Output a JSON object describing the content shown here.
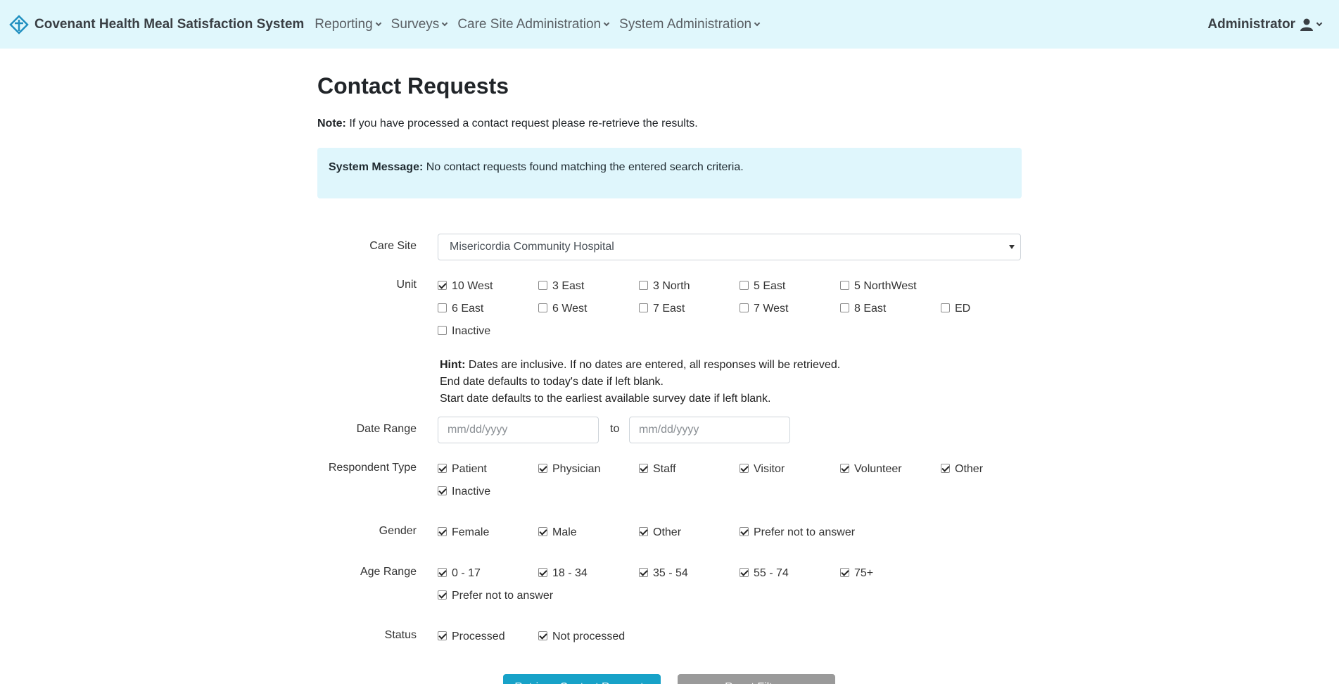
{
  "navbar": {
    "brand": "Covenant Health Meal Satisfaction System",
    "items": [
      {
        "label": "Reporting"
      },
      {
        "label": "Surveys"
      },
      {
        "label": "Care Site Administration"
      },
      {
        "label": "System Administration"
      }
    ],
    "user": "Administrator"
  },
  "page": {
    "title": "Contact Requests",
    "note_label": "Note:",
    "note_text": " If you have processed a contact request please re-retrieve the results.",
    "alert_label": "System Message:",
    "alert_text": " No contact requests found matching the entered search criteria."
  },
  "form": {
    "care_site_label": "Care Site",
    "care_site_value": "Misericordia Community Hospital",
    "unit_label": "Unit",
    "units": [
      {
        "label": "10 West",
        "checked": true
      },
      {
        "label": "3 East",
        "checked": false
      },
      {
        "label": "3 North",
        "checked": false
      },
      {
        "label": "5 East",
        "checked": false
      },
      {
        "label": "5 NorthWest",
        "checked": false
      },
      {
        "label": "6 East",
        "checked": false
      },
      {
        "label": "6 West",
        "checked": false
      },
      {
        "label": "7 East",
        "checked": false
      },
      {
        "label": "7 West",
        "checked": false
      },
      {
        "label": "8 East",
        "checked": false
      },
      {
        "label": "ED",
        "checked": false
      },
      {
        "label": "Inactive",
        "checked": false
      }
    ],
    "hint_label": "Hint:",
    "hint_line1": " Dates are inclusive. If no dates are entered, all responses will be retrieved.",
    "hint_line2": "End date defaults to today's date if left blank.",
    "hint_line3": "Start date defaults to the earliest available survey date if left blank.",
    "date_range_label": "Date Range",
    "date_from_placeholder": "mm/dd/yyyy",
    "date_to_label": "to",
    "date_to_placeholder": "mm/dd/yyyy",
    "respondent_label": "Respondent Type",
    "respondents": [
      {
        "label": "Patient",
        "checked": true
      },
      {
        "label": "Physician",
        "checked": true
      },
      {
        "label": "Staff",
        "checked": true
      },
      {
        "label": "Visitor",
        "checked": true
      },
      {
        "label": "Volunteer",
        "checked": true
      },
      {
        "label": "Other",
        "checked": true
      },
      {
        "label": "Inactive",
        "checked": true
      }
    ],
    "gender_label": "Gender",
    "genders": [
      {
        "label": "Female",
        "checked": true
      },
      {
        "label": "Male",
        "checked": true
      },
      {
        "label": "Other",
        "checked": true
      },
      {
        "label": "Prefer not to answer",
        "checked": true
      }
    ],
    "age_label": "Age Range",
    "ages": [
      {
        "label": "0 - 17",
        "checked": true
      },
      {
        "label": "18 - 34",
        "checked": true
      },
      {
        "label": "35 - 54",
        "checked": true
      },
      {
        "label": "55 - 74",
        "checked": true
      },
      {
        "label": "75+",
        "checked": true
      },
      {
        "label": "Prefer not to answer",
        "checked": true
      }
    ],
    "status_label": "Status",
    "statuses": [
      {
        "label": "Processed",
        "checked": true
      },
      {
        "label": "Not processed",
        "checked": true
      }
    ],
    "retrieve_button": "Retrieve Contact Requests",
    "reset_button": "Reset Filters"
  },
  "colors": {
    "navbar_bg": "#e0f7fc",
    "alert_bg": "#dff6fc",
    "primary": "#17a2c8",
    "secondary": "#9a9a9a"
  },
  "icons": {
    "brand": "cross-diamond-logo-icon",
    "user": "user-icon",
    "caret": "chevron-down-icon"
  }
}
